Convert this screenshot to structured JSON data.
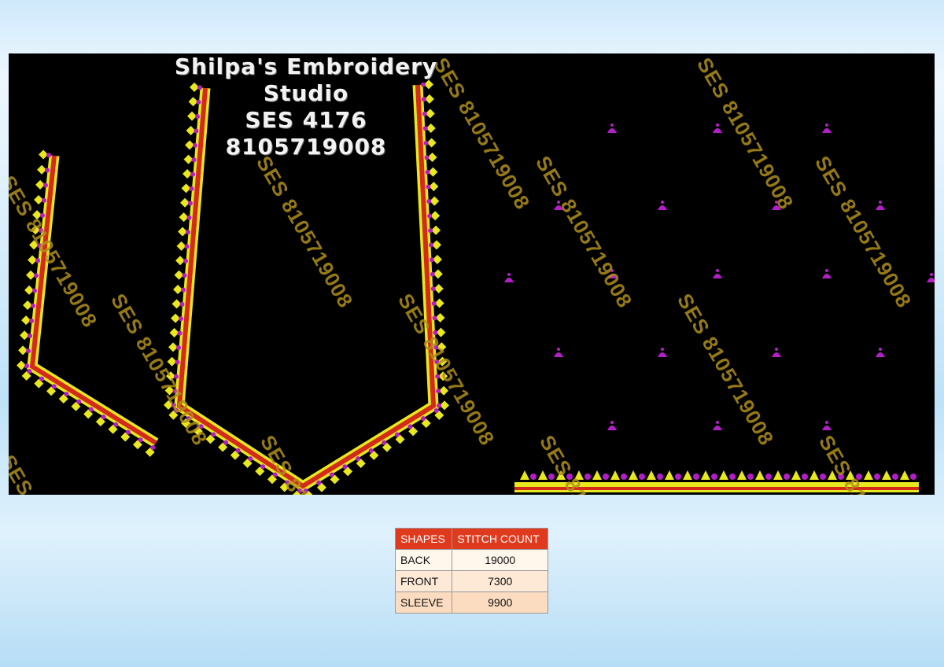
{
  "design": {
    "studio_name": "Shilpa's Embroidery Studio",
    "design_code": "SES  4176",
    "phone": "8105719008",
    "watermark_text": "SES 8105719008"
  },
  "stitch_table": {
    "headers": [
      "SHAPES",
      "STITCH COUNT"
    ],
    "rows": [
      {
        "shape": "BACK",
        "count": "19000"
      },
      {
        "shape": "FRONT",
        "count": "7300"
      },
      {
        "shape": "SLEEVE",
        "count": "9900"
      }
    ]
  },
  "colors": {
    "background_fabric": "#000000",
    "border_yellow": "#e8e81e",
    "border_red": "#d32a1a",
    "motif_magenta": "#b41ec8",
    "watermark": "#b08f1a",
    "table_header": "#e03a1e"
  }
}
